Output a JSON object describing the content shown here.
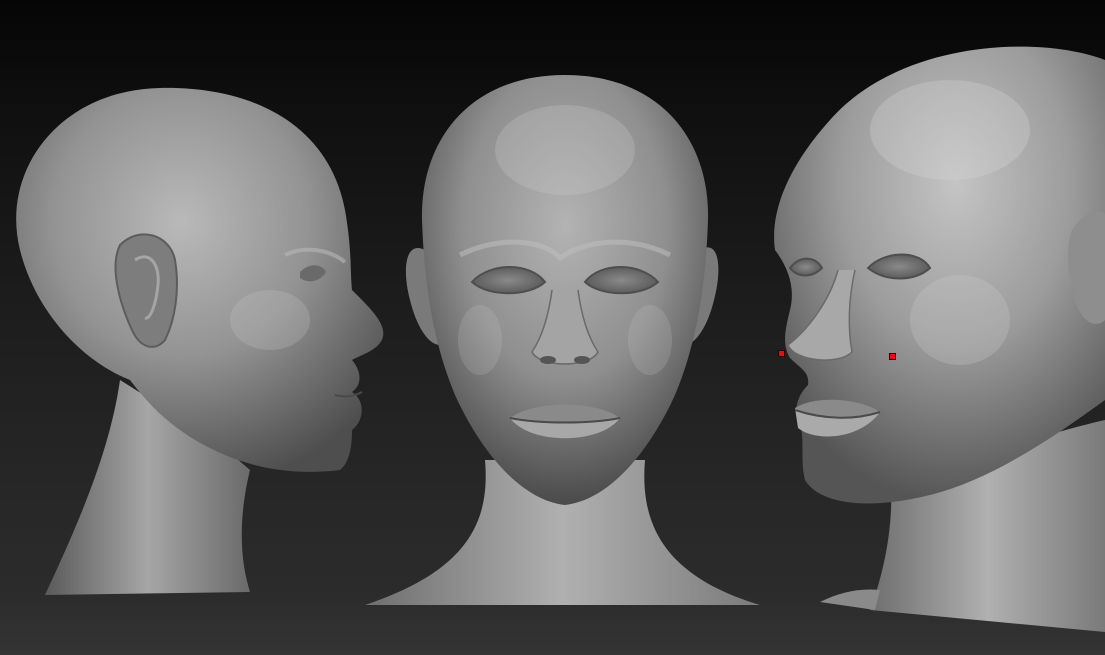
{
  "viewport": {
    "description_icon": "sculpt-viewport",
    "background_top": "#050505",
    "background_bottom": "#2e2e2e"
  },
  "models": [
    {
      "name": "head-profile-view",
      "view": "side"
    },
    {
      "name": "head-front-view",
      "view": "front"
    },
    {
      "name": "head-three-quarter-view",
      "view": "three-quarter"
    }
  ],
  "material_color": "#9a9a9a",
  "markers": {
    "color": "#e01010",
    "count": 2
  }
}
